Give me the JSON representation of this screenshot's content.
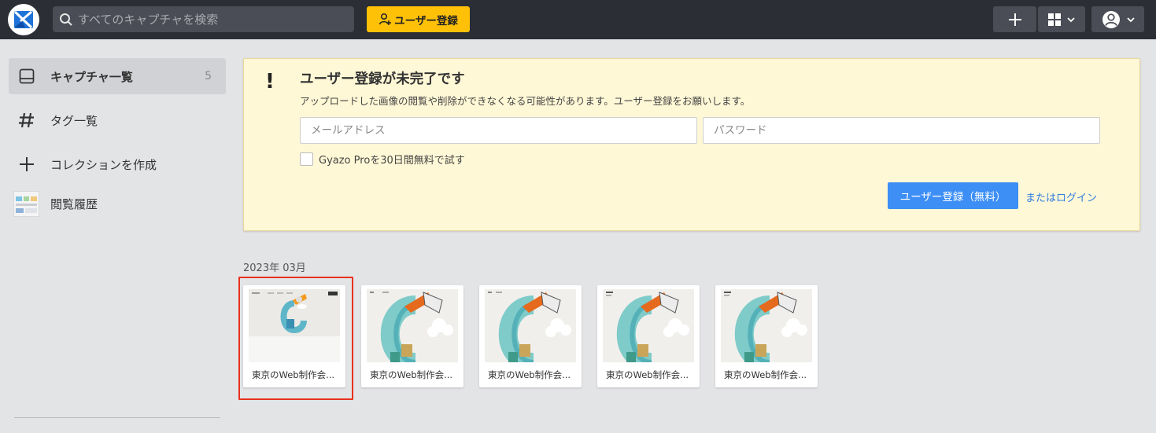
{
  "header": {
    "search_placeholder": "すべてのキャプチャを検索",
    "signup_label": "ユーザー登録"
  },
  "sidebar": {
    "items": [
      {
        "label": "キャプチャ一覧",
        "count": "5"
      },
      {
        "label": "タグ一覧"
      },
      {
        "label": "コレクションを作成"
      },
      {
        "label": "閲覧履歴"
      }
    ]
  },
  "alert": {
    "icon": "!",
    "title": "ユーザー登録が未完了です",
    "description": "アップロードした画像の閲覧や削除ができなくなる可能性があります。ユーザー登録をお願いします。",
    "email_placeholder": "メールアドレス",
    "password_placeholder": "パスワード",
    "trial_label": "Gyazo Proを30日間無料で試す",
    "register_button": "ユーザー登録（無料）",
    "login_link": "またはログイン"
  },
  "captures": {
    "month": "2023年 03月",
    "items": [
      {
        "caption": "東京のWeb制作会..."
      },
      {
        "caption": "東京のWeb制作会..."
      },
      {
        "caption": "東京のWeb制作会..."
      },
      {
        "caption": "東京のWeb制作会..."
      },
      {
        "caption": "東京のWeb制作会..."
      }
    ]
  },
  "colors": {
    "topbar": "#2b2e35",
    "accent_yellow": "#ffc107",
    "primary_blue": "#3d8ff5",
    "selection_red": "#e8311e"
  }
}
